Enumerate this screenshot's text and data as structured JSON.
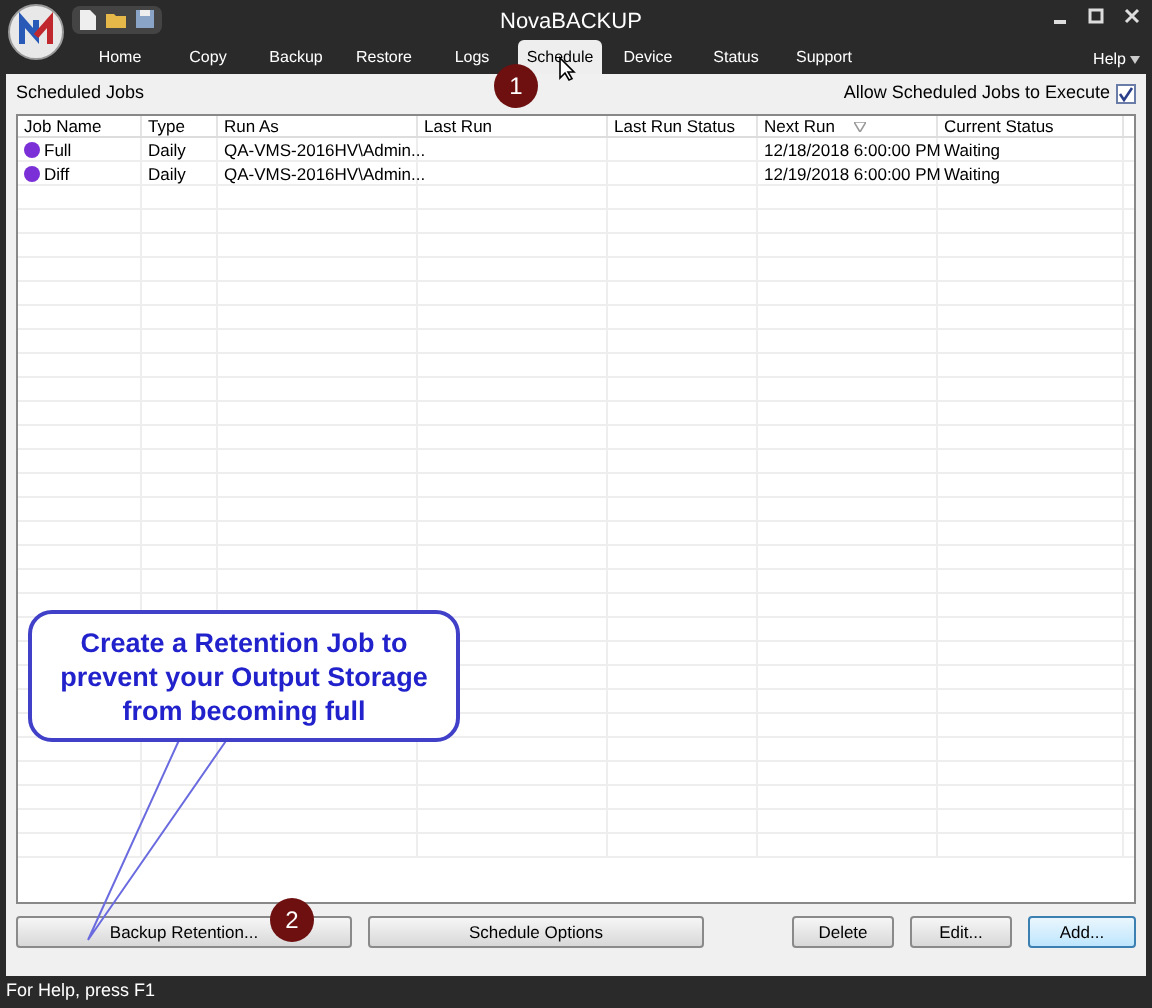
{
  "window": {
    "title": "NovaBACKUP"
  },
  "tabs": [
    {
      "label": "Home",
      "selected": false
    },
    {
      "label": "Copy",
      "selected": false
    },
    {
      "label": "Backup",
      "selected": false
    },
    {
      "label": "Restore",
      "selected": false
    },
    {
      "label": "Logs",
      "selected": false
    },
    {
      "label": "Schedule",
      "selected": true
    },
    {
      "label": "Device",
      "selected": false
    },
    {
      "label": "Status",
      "selected": false
    },
    {
      "label": "Support",
      "selected": false
    }
  ],
  "help_menu": "Help",
  "section_title": "Scheduled Jobs",
  "allow_execute": {
    "label": "Allow Scheduled Jobs to Execute",
    "checked": true
  },
  "table": {
    "columns": [
      {
        "label": "Job Name",
        "sorted": false
      },
      {
        "label": "Type",
        "sorted": false
      },
      {
        "label": "Run As",
        "sorted": false
      },
      {
        "label": "Last Run",
        "sorted": false
      },
      {
        "label": "Last Run Status",
        "sorted": false
      },
      {
        "label": "Next Run",
        "sorted": true
      },
      {
        "label": "Current Status",
        "sorted": false
      }
    ],
    "rows": [
      {
        "color": "#7b2fd6",
        "cells": [
          "Full",
          "Daily",
          "QA-VMS-2016HV\\Admin...",
          "",
          "",
          "12/18/2018 6:00:00 PM",
          "Waiting"
        ]
      },
      {
        "color": "#7b2fd6",
        "cells": [
          "Diff",
          "Daily",
          "QA-VMS-2016HV\\Admin...",
          "",
          "",
          "12/19/2018 6:00:00 PM",
          "Waiting"
        ]
      }
    ]
  },
  "buttons_left": [
    "Backup Retention...",
    "Schedule Options"
  ],
  "buttons_right": [
    {
      "label": "Delete",
      "selected": false
    },
    {
      "label": "Edit...",
      "selected": false
    },
    {
      "label": "Add...",
      "selected": true
    }
  ],
  "callout": "Create a Retention Job to prevent your Output Storage from becoming full",
  "markers": [
    "1",
    "2"
  ],
  "status_bar": "For Help, press F1"
}
